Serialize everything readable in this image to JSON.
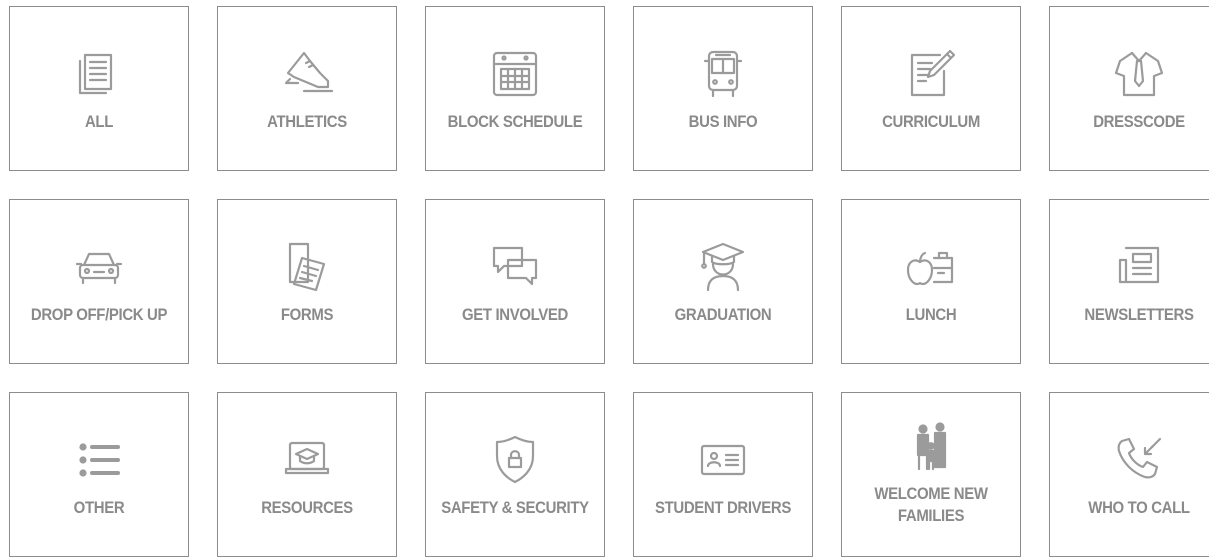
{
  "tiles": [
    {
      "label": "ALL",
      "icon": "documents-icon"
    },
    {
      "label": "ATHLETICS",
      "icon": "sneaker-icon"
    },
    {
      "label": "BLOCK SCHEDULE",
      "icon": "calendar-icon"
    },
    {
      "label": "BUS INFO",
      "icon": "bus-icon"
    },
    {
      "label": "CURRICULUM",
      "icon": "clipboard-pencil-icon"
    },
    {
      "label": "DRESSCODE",
      "icon": "shirt-tie-icon"
    },
    {
      "label": "DROP OFF/PICK UP",
      "icon": "car-icon"
    },
    {
      "label": "FORMS",
      "icon": "forms-icon"
    },
    {
      "label": "GET INVOLVED",
      "icon": "chat-bubbles-icon"
    },
    {
      "label": "GRADUATION",
      "icon": "graduate-icon"
    },
    {
      "label": "LUNCH",
      "icon": "apple-lunchbox-icon"
    },
    {
      "label": "NEWSLETTERS",
      "icon": "newspaper-icon"
    },
    {
      "label": "OTHER",
      "icon": "list-icon"
    },
    {
      "label": "RESOURCES",
      "icon": "laptop-graduation-cap-icon"
    },
    {
      "label": "SAFETY & SECURITY",
      "icon": "shield-lock-icon"
    },
    {
      "label": "STUDENT DRIVERS",
      "icon": "id-card-icon"
    },
    {
      "label": "WELCOME NEW\nFAMILIES",
      "icon": "family-icon"
    },
    {
      "label": "WHO TO CALL",
      "icon": "phone-call-icon"
    }
  ],
  "colors": {
    "border": "#8c8c8c",
    "icon": "#9b9b9b",
    "text": "#8a8a8a"
  }
}
